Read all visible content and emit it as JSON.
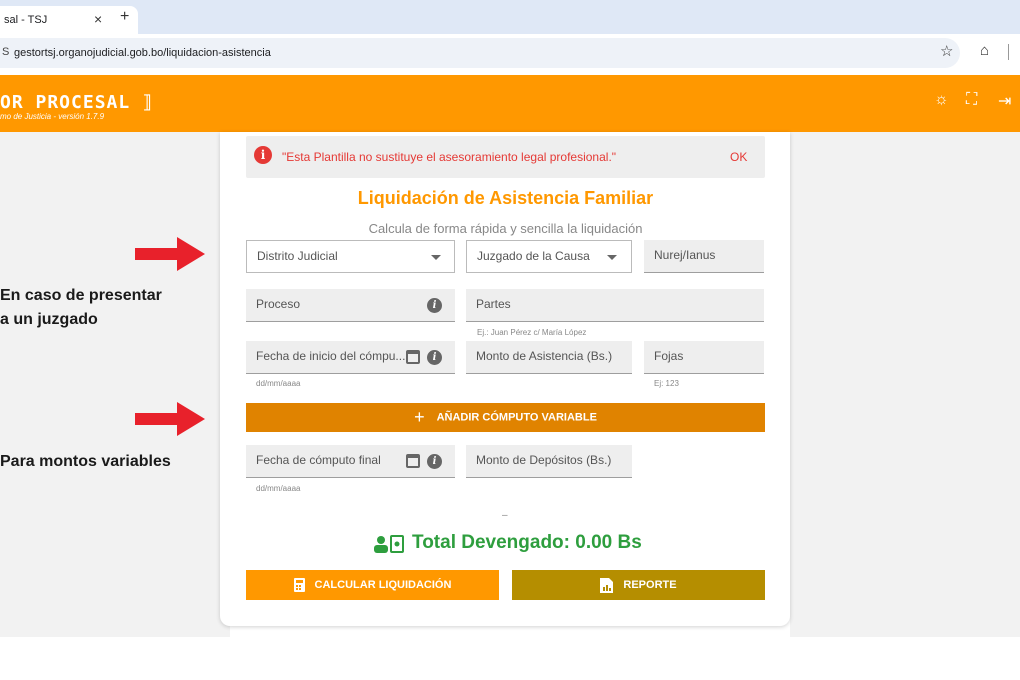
{
  "browser": {
    "tab_title": "sal - TSJ",
    "tab_close": "×",
    "new_tab": "+",
    "url": "gestortsj.organojudicial.gob.bo/liquidacion-asistencia"
  },
  "app": {
    "brand": "OR PROCESAL",
    "subtitle": "mo de Justicia - versión 1.7.9",
    "brand_color": "#ff9800"
  },
  "alert": {
    "message": "\"Esta Plantilla no sustituye el asesoramiento legal profesional.\"",
    "ok_label": "OK",
    "icon": "i"
  },
  "form": {
    "title": "Liquidación de Asistencia Familiar",
    "subtitle": "Calcula de forma rápida y sencilla la liquidación",
    "distrito": "Distrito Judicial",
    "juzgado": "Juzgado de la Causa",
    "nurej": "Nurej/Ianus",
    "proceso": "Proceso",
    "partes": "Partes",
    "partes_hint": "Ej.: Juan Pérez c/ María López",
    "fecha_inicio": "Fecha de inicio del cómpu...",
    "fecha_inicio_hint": "dd/mm/aaaa",
    "monto_asistencia": "Monto de Asistencia (Bs.)",
    "fojas": "Fojas",
    "fojas_hint": "Ej: 123",
    "add_button": "AÑADIR CÓMPUTO VARIABLE",
    "add_plus": "+",
    "fecha_final": "Fecha de cómputo final",
    "fecha_final_hint": "dd/mm/aaaa",
    "monto_depositos": "Monto de Depósitos (Bs.)",
    "separator": "–",
    "total": "Total Devengado: 0.00 Bs",
    "calc_button": "CALCULAR LIQUIDACIÓN",
    "report_button": "REPORTE",
    "info_glyph": "i"
  },
  "annotations": {
    "note1_line1": "En caso de presentar",
    "note1_line2": "a un juzgado",
    "note2": "Para montos variables"
  }
}
